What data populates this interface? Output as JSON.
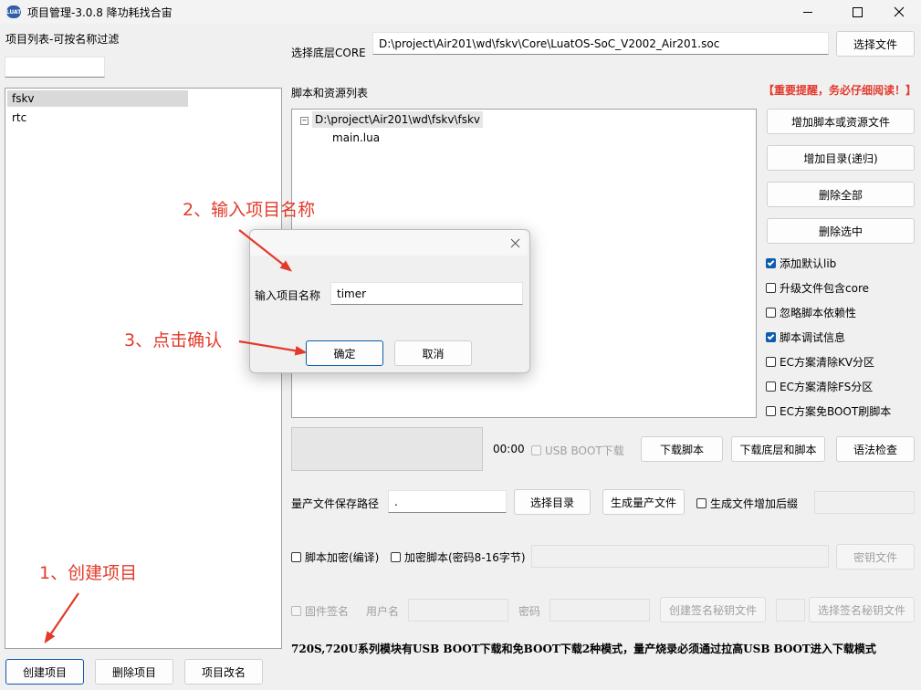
{
  "window": {
    "title": "项目管理-3.0.8 降功耗找合宙",
    "logo_text": "LUAT"
  },
  "left": {
    "list_label": "项目列表-可按名称过滤",
    "filter_value": "",
    "projects": [
      "fskv",
      "rtc"
    ],
    "buttons": {
      "create": "创建项目",
      "delete": "删除项目",
      "rename": "项目改名"
    }
  },
  "core": {
    "label": "选择底层CORE",
    "path": "D:\\project\\Air201\\wd\\fskv\\Core\\LuatOS-SoC_V2002_Air201.soc",
    "select_btn": "选择文件"
  },
  "scripts": {
    "label": "脚本和资源列表",
    "warning": "【重要提醒，务必仔细阅读！】",
    "tree_root": "D:\\project\\Air201\\wd\\fskv\\fskv",
    "tree_child": "main.lua",
    "side_buttons": [
      "增加脚本或资源文件",
      "增加目录(递归)",
      "删除全部",
      "删除选中"
    ],
    "options": [
      {
        "label": "添加默认lib",
        "checked": true
      },
      {
        "label": "升级文件包含core",
        "checked": false
      },
      {
        "label": "忽略脚本依赖性",
        "checked": false
      },
      {
        "label": "脚本调试信息",
        "checked": true
      },
      {
        "label": "EC方案清除KV分区",
        "checked": false
      },
      {
        "label": "EC方案清除FS分区",
        "checked": false
      },
      {
        "label": "EC方案免BOOT刷脚本",
        "checked": false
      }
    ]
  },
  "download": {
    "time": "00:00",
    "usb_boot": "USB BOOT下载",
    "btn_download": "下载脚本",
    "btn_download_all": "下载底层和脚本",
    "btn_check": "语法检查"
  },
  "mass": {
    "label": "量产文件保存路径",
    "path": ".",
    "select_dir": "选择目录",
    "generate": "生成量产文件",
    "suffix": "生成文件增加后缀"
  },
  "encrypt": {
    "script_encrypt": "脚本加密(编译)",
    "encrypt_pwd": "加密脚本(密码8-16字节)",
    "key_file": "密钥文件"
  },
  "sign": {
    "firmware_sign": "固件签名",
    "username": "用户名",
    "password": "密码",
    "create_key": "创建签名秘钥文件",
    "select_key": "选择签名秘钥文件"
  },
  "footer_note": "720S,720U系列模块有USB BOOT下载和免BOOT下载2种模式，量产烧录必须通过拉高USB BOOT进入下载模式",
  "dialog": {
    "label": "输入项目名称",
    "value": "timer",
    "ok": "确定",
    "cancel": "取消"
  },
  "annotations": {
    "step1": "1、创建项目",
    "step2": "2、输入项目名称",
    "step3": "3、点击确认"
  },
  "colors": {
    "annotation": "#e33a2a",
    "checkbox_on": "#0b5cad"
  }
}
